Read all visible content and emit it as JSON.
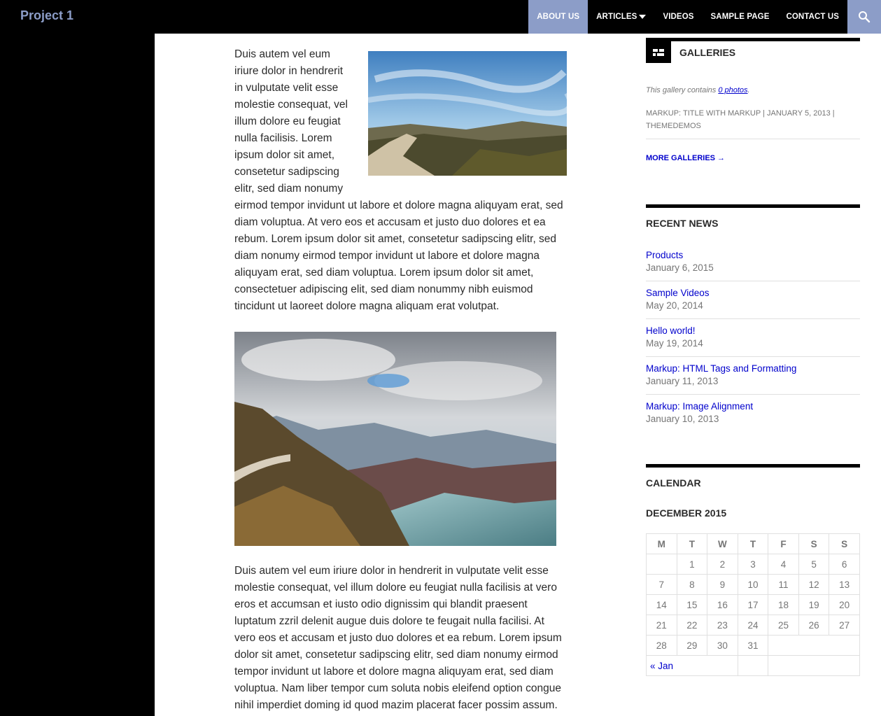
{
  "header": {
    "site_title": "Project 1",
    "nav": [
      {
        "label": "About Us",
        "active": true
      },
      {
        "label": "Articles",
        "has_dropdown": true
      },
      {
        "label": "Videos"
      },
      {
        "label": "Sample Page"
      },
      {
        "label": "Contact Us"
      }
    ],
    "search_icon": "search-icon"
  },
  "colors": {
    "accent": "#8c9dc8",
    "link": "#0000cc",
    "text": "#2b2b2b",
    "muted": "#767676"
  },
  "content": {
    "paragraph_1": "Duis autem vel eum iriure dolor in hendrerit in vulputate velit esse molestie consequat, vel illum dolore eu feugiat nulla facilisis. Lorem ipsum dolor sit amet, consetetur sadipscing elitr, sed diam nonumy eirmod tempor invidunt ut labore et dolore magna aliquyam erat, sed diam voluptua. At vero eos et accusam et justo duo dolores et ea rebum. Lorem ipsum dolor sit amet, consetetur sadipscing elitr, sed diam nonumy eirmod tempor invidunt ut labore et dolore magna aliquyam erat, sed diam voluptua. Lorem ipsum dolor sit amet, consectetuer adipiscing elit, sed diam nonummy nibh euismod tincidunt ut laoreet dolore magna aliquam erat volutpat.",
    "paragraph_2": "Duis autem vel eum iriure dolor in hendrerit in vulputate velit esse molestie consequat, vel illum dolore eu feugiat nulla facilisis at vero eros et accumsan et iusto odio dignissim qui blandit praesent luptatum zzril delenit augue duis dolore te feugait nulla facilisi. At vero eos et accusam et justo duo dolores et ea rebum. Lorem ipsum dolor sit amet, consetetur sadipscing elitr, sed diam nonumy eirmod tempor invidunt ut labore et dolore magna aliquyam erat, sed diam voluptua. Nam liber tempor cum soluta nobis eleifend option congue nihil imperdiet doming id quod mazim placerat facer possim assum."
  },
  "galleries": {
    "title": "Galleries",
    "icon": "gallery-icon",
    "text_prefix": "This gallery contains ",
    "photo_link": "0 photos",
    "text_suffix": ".",
    "meta_category": "Markup: Title With Markup",
    "meta_sep1": " | ",
    "meta_date": "January 5, 2013",
    "meta_sep2": " | ",
    "meta_author": "Themedemos",
    "more_link": "More Galleries →"
  },
  "recent_news": {
    "title": "Recent News",
    "items": [
      {
        "title": "Products",
        "date": "January 6, 2015"
      },
      {
        "title": "Sample Videos",
        "date": "May 20, 2014"
      },
      {
        "title": "Hello world!",
        "date": "May 19, 2014"
      },
      {
        "title": "Markup: HTML Tags and Formatting",
        "date": "January 11, 2013"
      },
      {
        "title": "Markup: Image Alignment",
        "date": "January 10, 2013"
      }
    ]
  },
  "calendar": {
    "title": "Calendar",
    "caption": "December 2015",
    "weekdays": [
      "M",
      "T",
      "W",
      "T",
      "F",
      "S",
      "S"
    ],
    "weeks": [
      [
        "",
        "1",
        "2",
        "3",
        "4",
        "5",
        "6"
      ],
      [
        "7",
        "8",
        "9",
        "10",
        "11",
        "12",
        "13"
      ],
      [
        "14",
        "15",
        "16",
        "17",
        "18",
        "19",
        "20"
      ],
      [
        "21",
        "22",
        "23",
        "24",
        "25",
        "26",
        "27"
      ],
      [
        "28",
        "29",
        "30",
        "31",
        "",
        "",
        ""
      ]
    ],
    "prev_link": "« Jan"
  }
}
